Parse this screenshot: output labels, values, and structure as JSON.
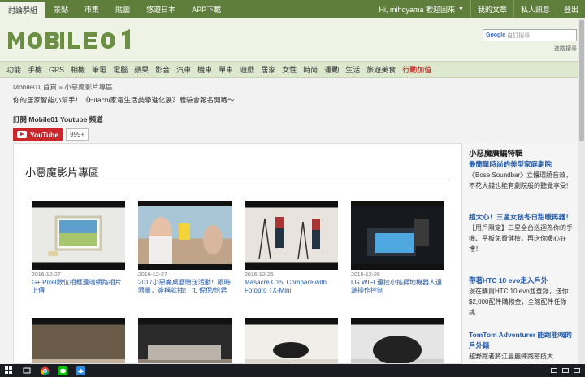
{
  "topbar": {
    "tabs": [
      {
        "label": "討論群組",
        "active": true
      },
      {
        "label": "景點"
      },
      {
        "label": "市集"
      },
      {
        "label": "貼圖"
      },
      {
        "label": "悠遊日本"
      },
      {
        "label": "APP下載"
      }
    ],
    "user": "Hi, mihoyama 歡迎回來",
    "links": [
      "我的文章",
      "私人訊息",
      "登出"
    ]
  },
  "header": {
    "logo_text": "MOBILE01",
    "search_placeholder": "自訂搜尋",
    "search_brand": "Google",
    "advanced_search": "進階搜尋"
  },
  "categories": [
    "功能",
    "手機",
    "GPS",
    "相機",
    "筆電",
    "電腦",
    "蘋果",
    "影音",
    "汽車",
    "機車",
    "單車",
    "遊戲",
    "居家",
    "女性",
    "時尚",
    "運動",
    "生活",
    "旅遊美食",
    "行動加值"
  ],
  "breadcrumb": "Mobile01 首頁 » 小惡魔影片專區",
  "notice": "你的居家智能小幫手！《Hitachi家電生活美學進化展》體驗會報名開跑～",
  "subscribe": {
    "title": "訂閱 Mobile01 Youtube 頻道",
    "youtube_label": "YouTube",
    "count": "999+"
  },
  "section_title": "小惡魔影片專區",
  "videos": [
    {
      "date": "2016-12-27",
      "caption": "G+ Pixel數位相框遠端網路相片上傳"
    },
    {
      "date": "2016-12-27",
      "caption": "2017小惡魔桌曆贈送活動！限時限量，簽稱就抽！ ft. 倪倪/恰君"
    },
    {
      "date": "2016-12-26",
      "caption": "Masacre C15i Compare with Fotopro TX-Mini"
    },
    {
      "date": "2016-12-26",
      "caption": "LG WIFI 遠控小搖掃地機器人遠端操作控制"
    },
    {
      "date": "",
      "caption": ""
    },
    {
      "date": "",
      "caption": ""
    },
    {
      "date": "",
      "caption": ""
    },
    {
      "date": "",
      "caption": ""
    }
  ],
  "sidebar": {
    "title": "小惡魔廣編特輯",
    "items": [
      {
        "headline": "最簡單時尚的美型家庭劇院",
        "body": "《Bose Soundbar》立體環繞音效，不花大錢也能有劇院般的聽覺享受!"
      },
      {
        "headline": "超大心！三星女孩冬日甜暖再器！",
        "body": "【用戶限定】三星全台巡迴為你的手機、平板免費健檢，再送你暖心好禮！"
      },
      {
        "headline": "帶著HTC 10 evo走入戶外",
        "body": "現在購買HTC 10 evo並登錄，送你$2,000配件購物金，全館配件任你挑"
      },
      {
        "headline": "TomTom Adventurer 能跑能喝的戶外錶",
        "body": "越野跑者將江曼麗練跑密技大"
      }
    ]
  },
  "colors": {
    "topbar_bg": "#5f7e3b",
    "header_bg": "#eef3e6",
    "link_blue": "#245aa8",
    "hot_red": "#cc0000",
    "youtube_red": "#c8282b"
  }
}
